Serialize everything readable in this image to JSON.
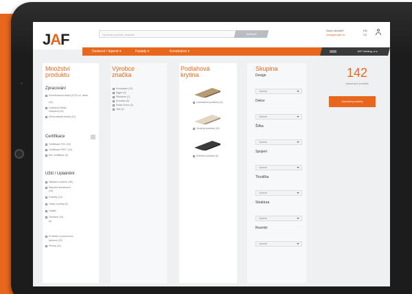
{
  "header": {
    "search_placeholder": "Vyhledat produkt, materiál...",
    "search_button": "Vyhledat",
    "user_line1": "Nový uživatel?",
    "user_login": "Zaregistrujte se",
    "lang_line1": "EN",
    "lang_line2": "CZ"
  },
  "nav": {
    "items": [
      "Deskové / lepené ▾",
      "Fasády ▾",
      "Konstrukce ▾"
    ],
    "right": "JAF Holding, a.s.",
    "accent": "#e8671c"
  },
  "filters": {
    "column1": {
      "title": [
        "Množství",
        "produktu"
      ],
      "sections": [
        {
          "title": "Zpracování",
          "items": [
            "Dřevotřísková deska (DTD) vč. lamin.",
            "(32)",
            "Lamelová deska",
            "nelepená (16)",
            "Dřevovláknitá deska (12)"
          ]
        },
        {
          "title": "Certifikace",
          "items": [
            "Certifikace FSC (18)",
            "Certifikace PEFC (24)",
            "Bez certifikace (9)"
          ]
        },
        {
          "title": "Užití / Uplatnění",
          "items": [
            "Nábytek a interiér (38)",
            "Stavební konstrukce",
            "(19)",
            "Podlahy (12)",
            "Obaly a palety (8)",
            "Ostatní",
            "Zahradní (14)",
            "(6)"
          ]
        },
        {
          "title": "",
          "items": [
            "Produkty s povrchovou",
            "úpravou (22)",
            "Přířezy (11)"
          ]
        }
      ]
    },
    "column2": {
      "title": [
        "Výrobce",
        "značka"
      ],
      "items": [
        "Kronospan (12)",
        "Egger (9)",
        "Pfleiderer (7)",
        "Kronotex (5)",
        "Swiss Krono (3)",
        "Jiné (4)"
      ]
    },
    "column3": {
      "title": [
        "Podlahová",
        "krytina"
      ],
      "items": [
        "Laminátová podlaha (14)",
        "Vinylová podlaha (10)",
        "Dřevěná podlaha (6)"
      ]
    },
    "column4": {
      "title": "Skupina",
      "dropdowns": [
        {
          "label": "Design",
          "value": "Vyberte"
        },
        {
          "label": "Dekor",
          "value": "Vyberte"
        },
        {
          "label": "Šířka",
          "value": "Vyberte"
        },
        {
          "label": "Spojení",
          "value": "Vyberte"
        },
        {
          "label": "Tloušťka",
          "value": "Vyberte"
        },
        {
          "label": "Struktura",
          "value": "Vyberte"
        },
        {
          "label": "Rozměr",
          "value": "Vyberte"
        }
      ]
    }
  },
  "results": {
    "count": "142",
    "label": "Nalezených produktů",
    "reset_button": "Zobrazit produkty"
  }
}
